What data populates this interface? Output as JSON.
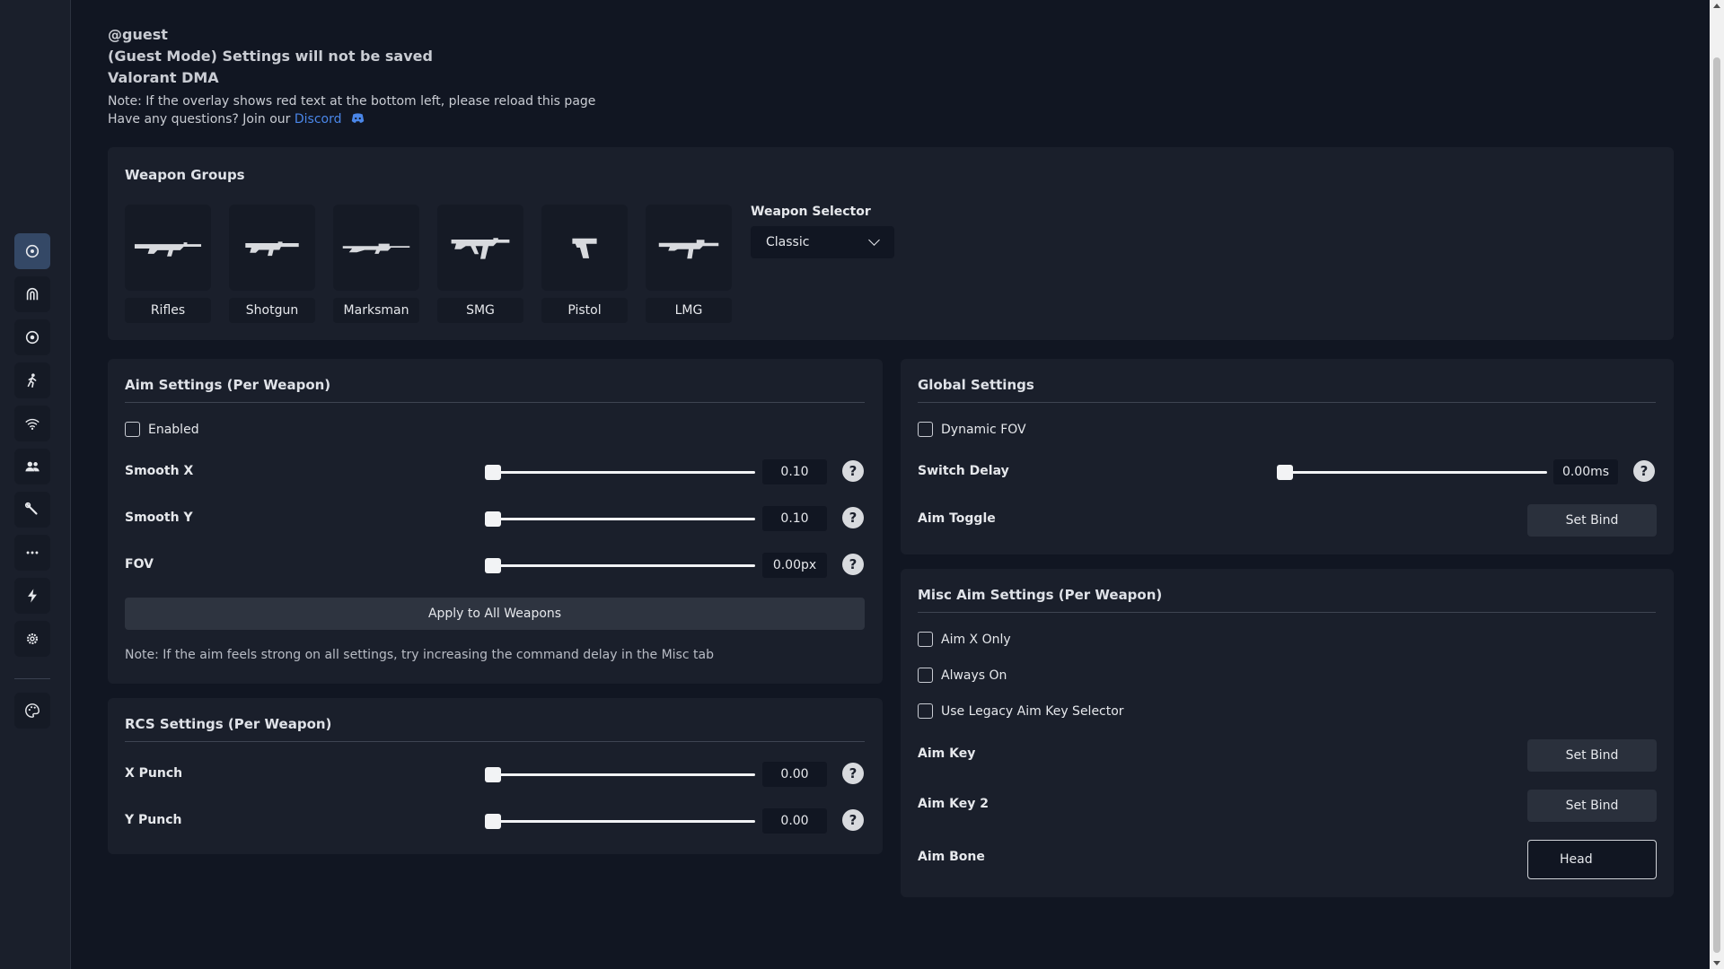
{
  "header": {
    "user": "@guest",
    "guest_notice": "(Guest Mode) Settings will not be saved",
    "product": "Valorant DMA",
    "overlay_note": "Note: If the overlay shows red text at the bottom left, please reload this page",
    "questions_prefix": "Have any questions? Join our ",
    "discord_link": "Discord"
  },
  "sidebar": {
    "items": [
      {
        "icon": "crosshair-icon",
        "active": true
      },
      {
        "icon": "magnet-icon",
        "active": false
      },
      {
        "icon": "target-icon",
        "active": false
      },
      {
        "icon": "running-person-icon",
        "active": false
      },
      {
        "icon": "wifi-icon",
        "active": false
      },
      {
        "icon": "users-icon",
        "active": false
      },
      {
        "icon": "wrench-icon",
        "active": false
      },
      {
        "icon": "more-icon",
        "active": false
      },
      {
        "icon": "lightning-icon",
        "active": false
      },
      {
        "icon": "gear-icon",
        "active": false
      },
      {
        "icon": "palette-icon",
        "active": false
      }
    ]
  },
  "weapon_groups": {
    "title": "Weapon Groups",
    "groups": [
      "Rifles",
      "Shotgun",
      "Marksman",
      "SMG",
      "Pistol",
      "LMG"
    ],
    "selector_label": "Weapon Selector",
    "selector_value": "Classic"
  },
  "aim_settings": {
    "title": "Aim Settings (Per Weapon)",
    "enabled_label": "Enabled",
    "enabled": false,
    "sliders": [
      {
        "label": "Smooth X",
        "value": "0.10",
        "fraction": 0.0
      },
      {
        "label": "Smooth Y",
        "value": "0.10",
        "fraction": 0.0
      },
      {
        "label": "FOV",
        "value": "0.00px",
        "fraction": 0.0
      }
    ],
    "apply_button": "Apply to All Weapons",
    "note": "Note: If the aim feels strong on all settings, try increasing the command delay in the Misc tab"
  },
  "rcs_settings": {
    "title": "RCS Settings (Per Weapon)",
    "sliders": [
      {
        "label": "X Punch",
        "value": "0.00",
        "fraction": 0.0
      },
      {
        "label": "Y Punch",
        "value": "0.00",
        "fraction": 0.0
      }
    ]
  },
  "global_settings": {
    "title": "Global Settings",
    "dynamic_fov_label": "Dynamic FOV",
    "switch_delay_label": "Switch Delay",
    "switch_delay_value": "0.00ms",
    "switch_delay_fraction": 0.0,
    "aim_toggle_label": "Aim Toggle",
    "set_bind": "Set Bind"
  },
  "misc_aim": {
    "title": "Misc Aim Settings (Per Weapon)",
    "checkboxes": [
      "Aim X Only",
      "Always On",
      "Use Legacy Aim Key Selector"
    ],
    "aim_key_label": "Aim Key",
    "aim_key2_label": "Aim Key 2",
    "set_bind": "Set Bind",
    "aim_bone_label": "Aim Bone",
    "aim_bone_value": "Head"
  },
  "help_glyph": "?",
  "colors": {
    "background": "#111622",
    "panel": "#1a1f2b",
    "accent": "#344866",
    "link": "#4a86e8"
  }
}
